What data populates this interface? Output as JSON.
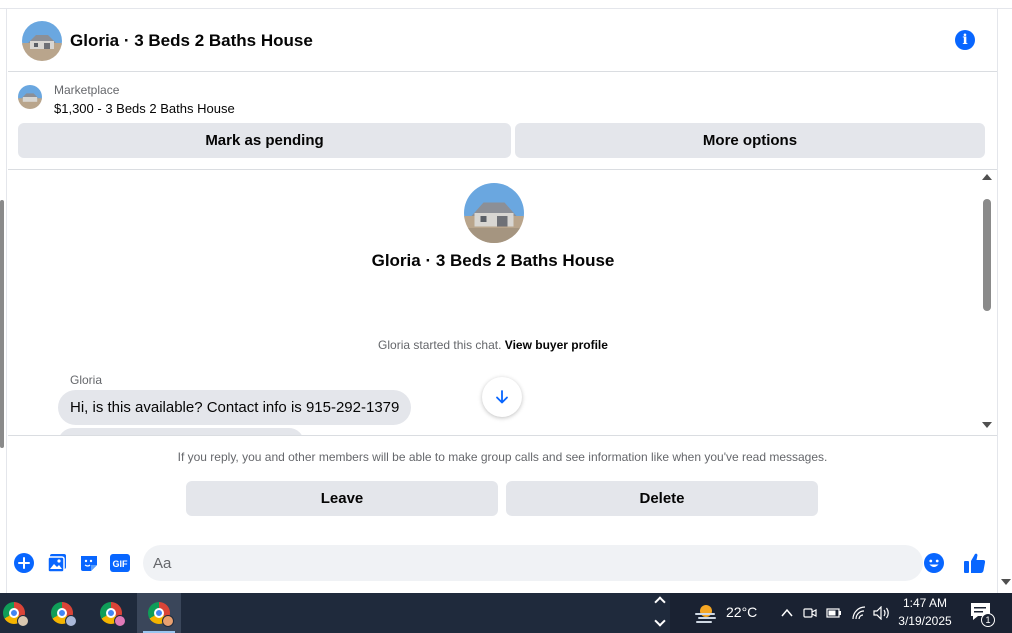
{
  "header": {
    "title": "Gloria · 3 Beds 2 Baths House",
    "info_icon": "info-icon"
  },
  "marketplace": {
    "label": "Marketplace",
    "item": "$1,300 - 3 Beds 2 Baths House",
    "pending_label": "Mark as pending",
    "more_label": "More options"
  },
  "conversation": {
    "title": "Gloria · 3 Beds 2 Baths House",
    "started_text": "Gloria started this chat.",
    "profile_link": "View buyer profile",
    "sender": "Gloria",
    "message": "Hi, is this available? Contact info is 915-292-1379"
  },
  "notice": {
    "text": "If you reply, you and other members will be able to make group calls and see information like when you've read messages.",
    "leave_label": "Leave",
    "delete_label": "Delete"
  },
  "composer": {
    "placeholder": "Aa",
    "gif_label": "GIF"
  },
  "taskbar": {
    "temperature": "22°C",
    "time": "1:47 AM",
    "date": "3/19/2025",
    "notification_count": "1"
  },
  "colors": {
    "accent": "#0866ff",
    "button_bg": "#e4e6eb",
    "taskbar_bg": "#1f2a3c"
  }
}
